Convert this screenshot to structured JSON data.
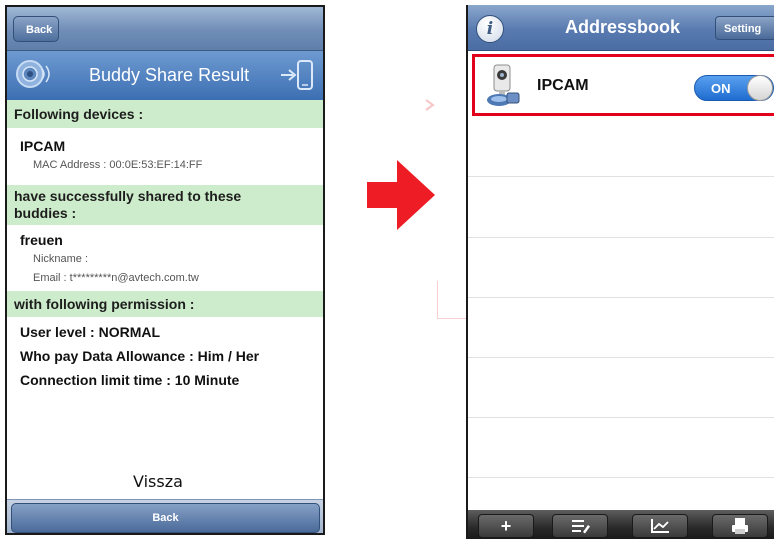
{
  "left_screen": {
    "back_top_label": "Back",
    "title": "Buddy Share Result",
    "section_devices": "Following devices :",
    "device_name": "IPCAM",
    "mac_address": "MAC Address : 00:0E:53:EF:14:FF",
    "section_shared_line1": "have successfully shared to these",
    "section_shared_line2": "buddies :",
    "buddy_name": "freuen",
    "nickname": "Nickname :",
    "email": "Email : t*********n@avtech.com.tw",
    "section_permission": "with following permission :",
    "user_level": "User level : NORMAL",
    "data_allowance": "Who pay Data Allowance : Him / Her",
    "connection_limit": "Connection limit time : 10 Minute",
    "caption": "Vissza",
    "back_bottom_label": "Back"
  },
  "right_screen": {
    "title": "Addressbook",
    "setting_label": "Setting",
    "device_name": "IPCAM",
    "toggle_label": "ON",
    "toggle_state": "on",
    "toolbar_icons": [
      "add-icon",
      "list-edit-icon",
      "chart-icon",
      "printer-icon"
    ],
    "toolbar_add_glyph": "+"
  },
  "colors": {
    "section_header_bg": "#cdeccb",
    "highlight_border": "#e3001b",
    "arrow": "#ee1c25"
  }
}
